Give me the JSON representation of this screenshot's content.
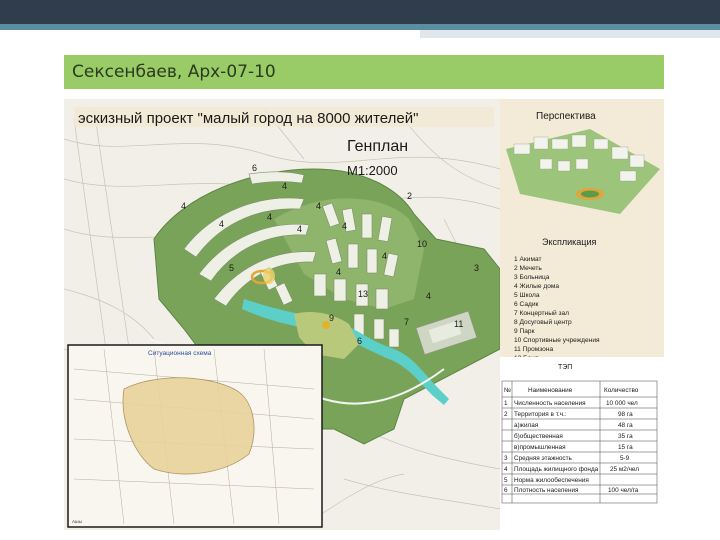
{
  "slide": {
    "header_title": "Сексенбаев, Арх-07-10"
  },
  "map": {
    "project_title": "эскизный проект \"малый город на 8000 жителей\"",
    "plan_title": "Генплан",
    "scale": "М1:2000",
    "zone_numbers": [
      "6",
      "4",
      "4",
      "4",
      "4",
      "4",
      "4",
      "4",
      "2",
      "10",
      "3",
      "5",
      "4",
      "4",
      "13",
      "7",
      "9",
      "6",
      "4",
      "11"
    ],
    "inset_title": "Ситуационная схема",
    "inset_corner": "Ашы"
  },
  "perspective": {
    "title": "Перспектива"
  },
  "explication": {
    "title": "Экспликация",
    "items": [
      "1 Акимат",
      "2 Мечеть",
      "3 Больница",
      "4 Жилые дома",
      "5 Школа",
      "6 Садик",
      "7 Концертный зал",
      "8 Досуговый центр",
      "9 Парк",
      "10 Спортивные учреждения",
      "11 Промзона",
      "12 Баня"
    ]
  },
  "tep": {
    "title": "ТЭП",
    "headers": [
      "№",
      "Наименование",
      "Количество"
    ],
    "rows": [
      [
        "1",
        "Численность населения",
        "10 000 чел"
      ],
      [
        "2",
        "Территория в т.ч.:",
        "98 га"
      ],
      [
        "",
        "а)жилая",
        "48 га"
      ],
      [
        "",
        "б)общественная",
        "35 га"
      ],
      [
        "",
        "в)промышленная",
        "15 га"
      ],
      [
        "3",
        "Средняя этажность",
        "5-9"
      ],
      [
        "4",
        "Площадь жилищного фонда",
        "25 м2/чел"
      ],
      [
        "5",
        "Норма жилообеспечения",
        ""
      ],
      [
        "6",
        "Плотность населения",
        "100 чел/га"
      ]
    ]
  }
}
